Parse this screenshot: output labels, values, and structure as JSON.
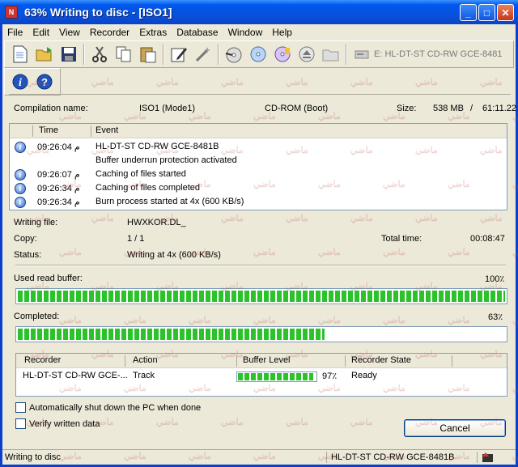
{
  "window": {
    "title": "63% Writing to disc - [ISO1]",
    "close_glyph": "✕",
    "maximize_glyph": "□",
    "minimize_glyph": "_"
  },
  "menu": [
    "File",
    "Edit",
    "View",
    "Recorder",
    "Extras",
    "Database",
    "Window",
    "Help"
  ],
  "toolbar": {
    "icons": [
      "new-document-icon",
      "open-folder-icon",
      "save-icon",
      "cut-icon",
      "copy-icon",
      "paste-icon",
      "edit-icon",
      "wizard-icon",
      "burn-icon",
      "disc-icon",
      "disc-info-icon",
      "eject-icon",
      "folder-icon"
    ],
    "drive_label": "E: HL-DT-ST CD-RW GCE-8481"
  },
  "toolbar2": {
    "icons": [
      "info-icon",
      "help-icon"
    ]
  },
  "compilation": {
    "name_label": "Compilation name:",
    "name_value": "ISO1 (Mode1)",
    "type_value": "CD-ROM (Boot)",
    "size_label": "Size:",
    "size_value": "538 MB",
    "size_sep": "/",
    "duration": "61:11.22"
  },
  "log": {
    "headers": {
      "time": "Time",
      "event": "Event"
    },
    "rows": [
      {
        "time": "09:26:04 م",
        "event": "HL-DT-ST CD-RW GCE-8481B",
        "icon": true
      },
      {
        "time": "",
        "event": "Buffer underrun protection activated",
        "icon": false
      },
      {
        "time": "09:26:07 م",
        "event": "Caching of files started",
        "icon": true
      },
      {
        "time": "09:26:34 م",
        "event": "Caching of files completed",
        "icon": true
      },
      {
        "time": "09:26:34 م",
        "event": "Burn process started at 4x (600 KB/s)",
        "icon": true
      }
    ]
  },
  "details": {
    "writing_file_label": "Writing file:",
    "writing_file_value": "HWXKOR.DL_",
    "copy_label": "Copy:",
    "copy_value": "1 / 1",
    "total_time_label": "Total time:",
    "total_time_value": "00:08:47",
    "status_label": "Status:",
    "status_value": "Writing at 4x (600 KB/s)"
  },
  "buffer": {
    "label": "Used read buffer:",
    "percent_text": "100٪",
    "level": 100
  },
  "completed": {
    "label": "Completed:",
    "percent_text": "63٪",
    "level": 63
  },
  "recorders": {
    "headers": {
      "recorder": "Recorder",
      "action": "Action",
      "buffer": "Buffer Level",
      "state": "Recorder State"
    },
    "rows": [
      {
        "recorder": "HL-DT-ST CD-RW GCE-...",
        "action": "Track",
        "buffer_text": "97٪",
        "buffer_level": 97,
        "state": "Ready"
      }
    ]
  },
  "options": {
    "shutdown_label": "Automatically shut down the PC when done",
    "verify_label": "Verify written data"
  },
  "cancel_label": "Cancel",
  "statusbar": {
    "left": "Writing to disc",
    "right": "HL-DT-ST CD-RW GCE-8481B"
  },
  "watermark": "ماضي"
}
